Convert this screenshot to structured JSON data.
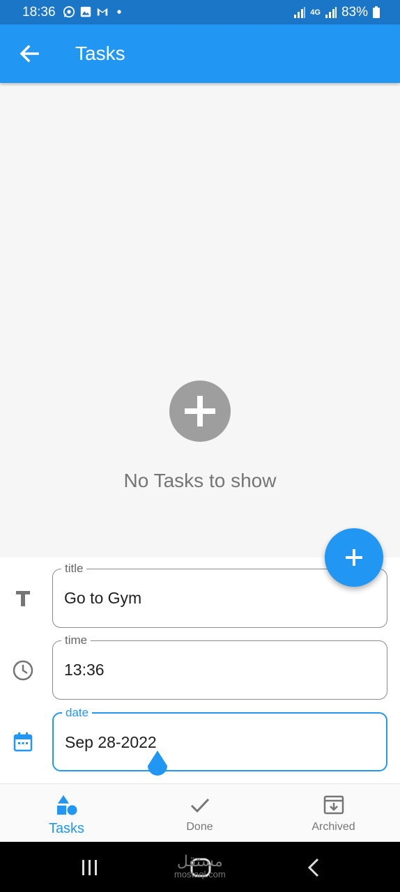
{
  "status_bar": {
    "time": "18:36",
    "network": "4G",
    "battery": "83%",
    "notification_icons": [
      "whatsapp-icon",
      "gallery-icon",
      "gmail-icon",
      "dot-icon"
    ]
  },
  "app_bar": {
    "title": "Tasks"
  },
  "empty_state": {
    "message": "No Tasks to show"
  },
  "form": {
    "title": {
      "label": "title",
      "value": "Go to Gym"
    },
    "time": {
      "label": "time",
      "value": "13:36"
    },
    "date": {
      "label": "date",
      "value": "Sep 28-2022"
    }
  },
  "bottom_nav": {
    "items": [
      {
        "label": "Tasks",
        "active": true
      },
      {
        "label": "Done",
        "active": false
      },
      {
        "label": "Archived",
        "active": false
      }
    ]
  },
  "watermark": {
    "arabic": "مستقل",
    "latin": "mostaql.com"
  },
  "colors": {
    "primary": "#2196f3",
    "status_bar": "#1b76c7",
    "empty_circle": "#9e9e9e"
  }
}
